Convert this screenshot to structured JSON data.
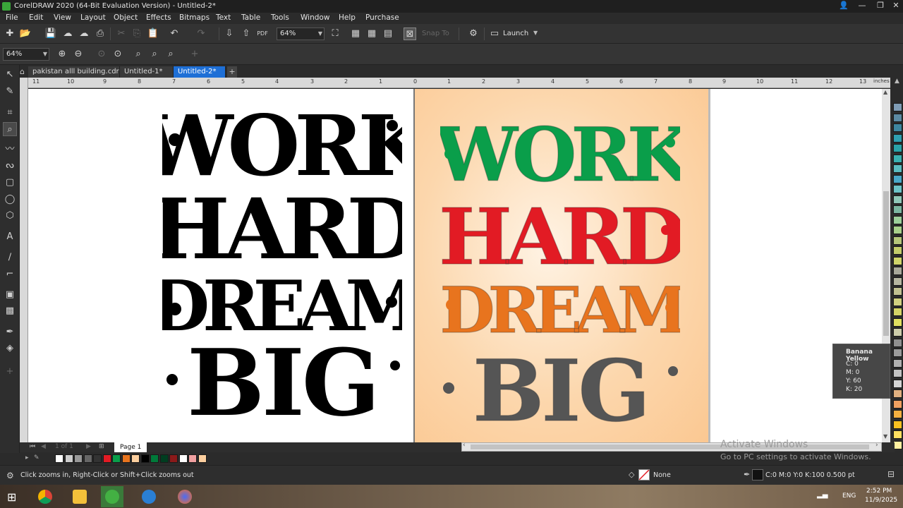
{
  "window": {
    "title": "CorelDRAW 2020 (64-Bit Evaluation Version) - Untitled-2*"
  },
  "menu": [
    "File",
    "Edit",
    "View",
    "Layout",
    "Object",
    "Effects",
    "Bitmaps",
    "Text",
    "Table",
    "Tools",
    "Window",
    "Help",
    "Purchase"
  ],
  "toolbar": {
    "zoom_value": "64%",
    "snap_label": "Snap To",
    "launch_label": "Launch"
  },
  "property_bar": {
    "zoom_value": "64%"
  },
  "tabs": [
    {
      "label": "pakistan alll building.cdr"
    },
    {
      "label": "Untitled-1*"
    },
    {
      "label": "Untitled-2*"
    }
  ],
  "ruler": {
    "ticks": [
      "11",
      "10",
      "9",
      "8",
      "7",
      "6",
      "5",
      "4",
      "3",
      "2",
      "1",
      "0",
      "1",
      "2",
      "3",
      "4",
      "5",
      "6",
      "7",
      "8",
      "9",
      "10",
      "11",
      "12",
      "13"
    ],
    "units": "inches"
  },
  "artwork": {
    "lines": [
      "WORK",
      "HARD",
      "DREAM",
      "BIG"
    ],
    "colors": {
      "work": "#0a9e4a",
      "hard": "#e21b24",
      "dream": "#e8741e",
      "big": "#555555",
      "black": "#000000",
      "bg_peach": "#fccf9f"
    }
  },
  "tooltip": {
    "title": "Banana Yellow",
    "lines": [
      "C: 0",
      "M: 0",
      "Y: 60",
      "K: 20"
    ]
  },
  "page_nav": {
    "pages": "1 of 1",
    "page_label": "Page 1"
  },
  "status": {
    "hint": "Click zooms in, Right-Click or Shift+Click zooms out",
    "fill_label": "None",
    "outline": "C:0 M:0 Y:0 K:100  0.500 pt"
  },
  "activation": {
    "title": "Activate Windows",
    "subtitle": "Go to PC settings to activate Windows."
  },
  "taskbar": {
    "lang": "ENG",
    "time": "2:52 PM",
    "date": "11/9/2025"
  },
  "palette_colors": [
    "#7f9cb5",
    "#5c8aa3",
    "#3e86a0",
    "#2f9fb0",
    "#2aa3a8",
    "#3ab0b0",
    "#5bbcc0",
    "#49a8c8",
    "#6cc3c7",
    "#8fc8b8",
    "#7bb6a0",
    "#9ccf9a",
    "#a8d08a",
    "#b5c67a",
    "#c3cc6a",
    "#cfd46a",
    "#a8a89a",
    "#b5b5a0",
    "#c0c090",
    "#d0d080",
    "#d4d466",
    "#e0e060",
    "#ccccaa",
    "#8f8f8f",
    "#9a9a9a",
    "#b0b0b0",
    "#c2c2c2",
    "#d4d4d4",
    "#e0b080",
    "#f0a060",
    "#f5b040",
    "#f8c020",
    "#ffe060",
    "#fff0a0"
  ],
  "document_palette": [
    "#ffffff",
    "#cccccc",
    "#999999",
    "#666666",
    "#333333",
    "#e21b24",
    "#0a9e4a",
    "#e8741e",
    "#fccf9f",
    "#000000",
    "#007a3a",
    "#003d20",
    "#8b1a1a",
    "#ffffff",
    "#f0a0a0",
    "#fccf9f"
  ]
}
